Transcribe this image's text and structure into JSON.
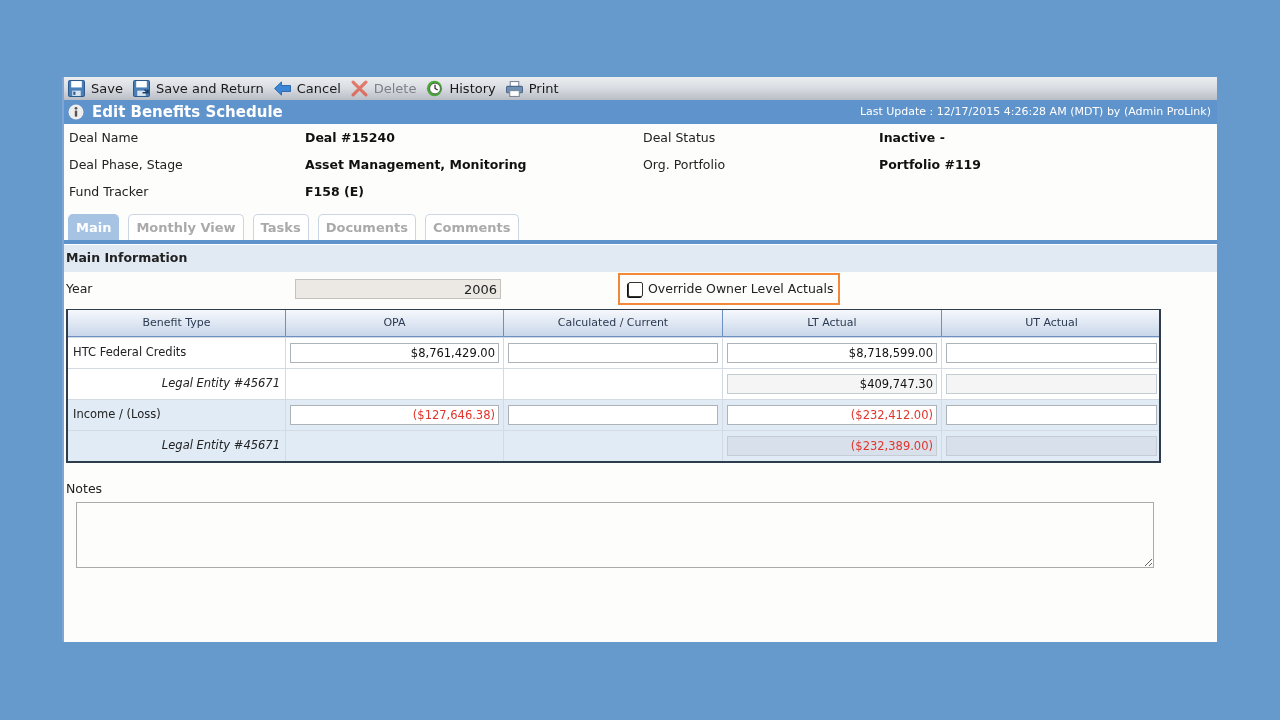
{
  "toolbar": [
    {
      "kind": "save",
      "label": "Save",
      "disabled": false
    },
    {
      "kind": "save_return",
      "label": "Save and Return",
      "disabled": false
    },
    {
      "kind": "cancel",
      "label": "Cancel",
      "disabled": false
    },
    {
      "kind": "delete",
      "label": "Delete",
      "disabled": true
    },
    {
      "kind": "history",
      "label": "History",
      "disabled": false
    },
    {
      "kind": "print",
      "label": "Print",
      "disabled": false
    }
  ],
  "header": {
    "title": "Edit Benefits Schedule",
    "last_update": "Last Update : 12/17/2015 4:26:28 AM (MDT) by (Admin ProLink)"
  },
  "details": [
    {
      "label": "Deal Name",
      "value": "Deal #15240"
    },
    {
      "label": "Deal Status",
      "value": "Inactive -"
    },
    {
      "label": "Deal Phase, Stage",
      "value": "Asset Management, Monitoring"
    },
    {
      "label": "Org. Portfolio",
      "value": "Portfolio #119"
    },
    {
      "label": "Fund Tracker",
      "value": "F158 (E)"
    }
  ],
  "tabs": [
    {
      "label": "Main",
      "selected": true
    },
    {
      "label": "Monthly View",
      "selected": false
    },
    {
      "label": "Tasks",
      "selected": false
    },
    {
      "label": "Documents",
      "selected": false
    },
    {
      "label": "Comments",
      "selected": false
    }
  ],
  "main_information": {
    "title": "Main Information",
    "year": {
      "label": "Year",
      "value": "2006",
      "readonly": true
    },
    "override": {
      "label": "Override Owner Level Actuals",
      "checked": false,
      "highlighted": true
    },
    "table": {
      "columns": [
        "Benefit Type",
        "OPA",
        "Calculated / Current",
        "LT Actual",
        "UT Actual"
      ],
      "rows": [
        {
          "benefit_type": "HTC Federal Credits",
          "cells": [
            {
              "kind": "field",
              "value": "$8,761,429.00",
              "negative": false,
              "readonly": false
            },
            {
              "kind": "field",
              "readonly": false
            },
            {
              "kind": "field",
              "value": "$8,718,599.00",
              "negative": false,
              "readonly": false
            },
            {
              "kind": "field",
              "readonly": false
            }
          ],
          "children": [
            {
              "benefit_type": "Legal Entity #45671",
              "cells": [
                {
                  "kind": "none"
                },
                {
                  "kind": "none"
                },
                {
                  "kind": "field",
                  "value": "$409,747.30",
                  "negative": false,
                  "readonly": true
                },
                {
                  "kind": "field",
                  "readonly": true
                }
              ]
            }
          ]
        },
        {
          "benefit_type": "Income / (Loss)",
          "cells": [
            {
              "kind": "field",
              "value": "($127,646.38)",
              "negative": true,
              "readonly": false
            },
            {
              "kind": "field",
              "readonly": false
            },
            {
              "kind": "field",
              "value": "($232,412.00)",
              "negative": true,
              "readonly": false
            },
            {
              "kind": "field",
              "readonly": false
            }
          ],
          "children": [
            {
              "benefit_type": "Legal Entity #45671",
              "cells": [
                {
                  "kind": "none"
                },
                {
                  "kind": "none"
                },
                {
                  "kind": "field",
                  "value": "($232,389.00)",
                  "negative": true,
                  "readonly": true
                },
                {
                  "kind": "field",
                  "readonly": true
                }
              ]
            }
          ]
        }
      ]
    }
  },
  "notes": {
    "label": "Notes"
  }
}
